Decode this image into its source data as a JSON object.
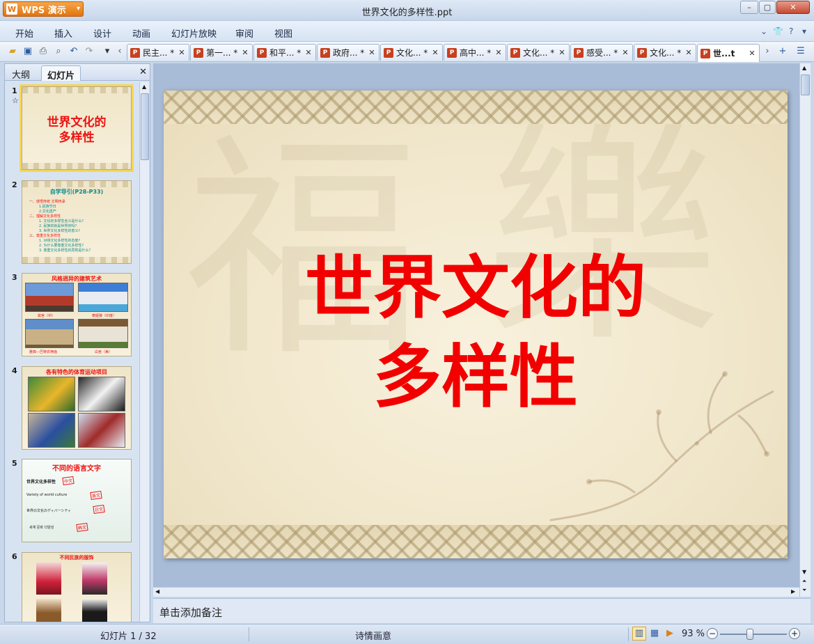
{
  "app": {
    "name": "WPS 演示",
    "logo_letter": "W"
  },
  "window": {
    "title": "世界文化的多样性.ppt"
  },
  "menu": [
    "开始",
    "插入",
    "设计",
    "动画",
    "幻灯片放映",
    "审阅",
    "视图"
  ],
  "doc_tabs": [
    {
      "label": "民主... *"
    },
    {
      "label": "第一... *"
    },
    {
      "label": "和平... *"
    },
    {
      "label": "政府... *"
    },
    {
      "label": "文化... *"
    },
    {
      "label": "高中... *"
    },
    {
      "label": "文化... *"
    },
    {
      "label": "感受... *"
    },
    {
      "label": "文化... *"
    },
    {
      "label": "世...t",
      "active": true
    }
  ],
  "left_panel": {
    "tabs": [
      "大纲",
      "幻灯片"
    ],
    "active_tab": "幻灯片",
    "thumbs": [
      {
        "num": "1",
        "title": "世界文化的多样性",
        "title_l1": "世界文化的",
        "title_l2": "多样性",
        "selected": true,
        "star": "☆"
      },
      {
        "num": "2",
        "title": "自学导引(P28-P33)",
        "lines": [
          "一、感悟传统  文明传承",
          "1.民族节日",
          "2.文化遗产",
          "二、理解文化多样性",
          "1. 文化的多样性含义是什么?",
          "2. 民族的就是世界的吗?",
          "3. 世界文化多样性的意义?",
          "三、尊重文化多样性",
          "1. 对待文化多样性的态度?",
          "2. 为什么要尊重文化多样性?",
          "3. 尊重文化多样性的原则是什么?"
        ]
      },
      {
        "num": "3",
        "title": "风格迥异的建筑艺术",
        "captions": [
          "故宫（中）",
          "泰姬陵（印度）",
          "雅典—巴特农神庙",
          "白宫（美）"
        ]
      },
      {
        "num": "4",
        "title": "各有特色的体育运动项目"
      },
      {
        "num": "5",
        "title": "不同的语言文字",
        "rows": [
          {
            "text": "世界文化多样性",
            "stamp": "中文"
          },
          {
            "text": "Variety of world culture",
            "stamp": "英文"
          },
          {
            "text": "世界の文化のディバーシティ",
            "stamp": "日文"
          },
          {
            "text": "세계 문화 다양성",
            "stamp": "韩文"
          }
        ]
      },
      {
        "num": "6",
        "title": "不同民族的服饰"
      }
    ]
  },
  "slide": {
    "title_line1": "世界文化的",
    "title_line2": "多样性"
  },
  "notes": {
    "placeholder": "单击添加备注"
  },
  "status": {
    "slide_counter": "幻灯片 1 / 32",
    "theme": "诗情画意",
    "zoom": "93 %"
  },
  "colors": {
    "title_red": "#f20000",
    "accent_orange": "#e2740e"
  }
}
